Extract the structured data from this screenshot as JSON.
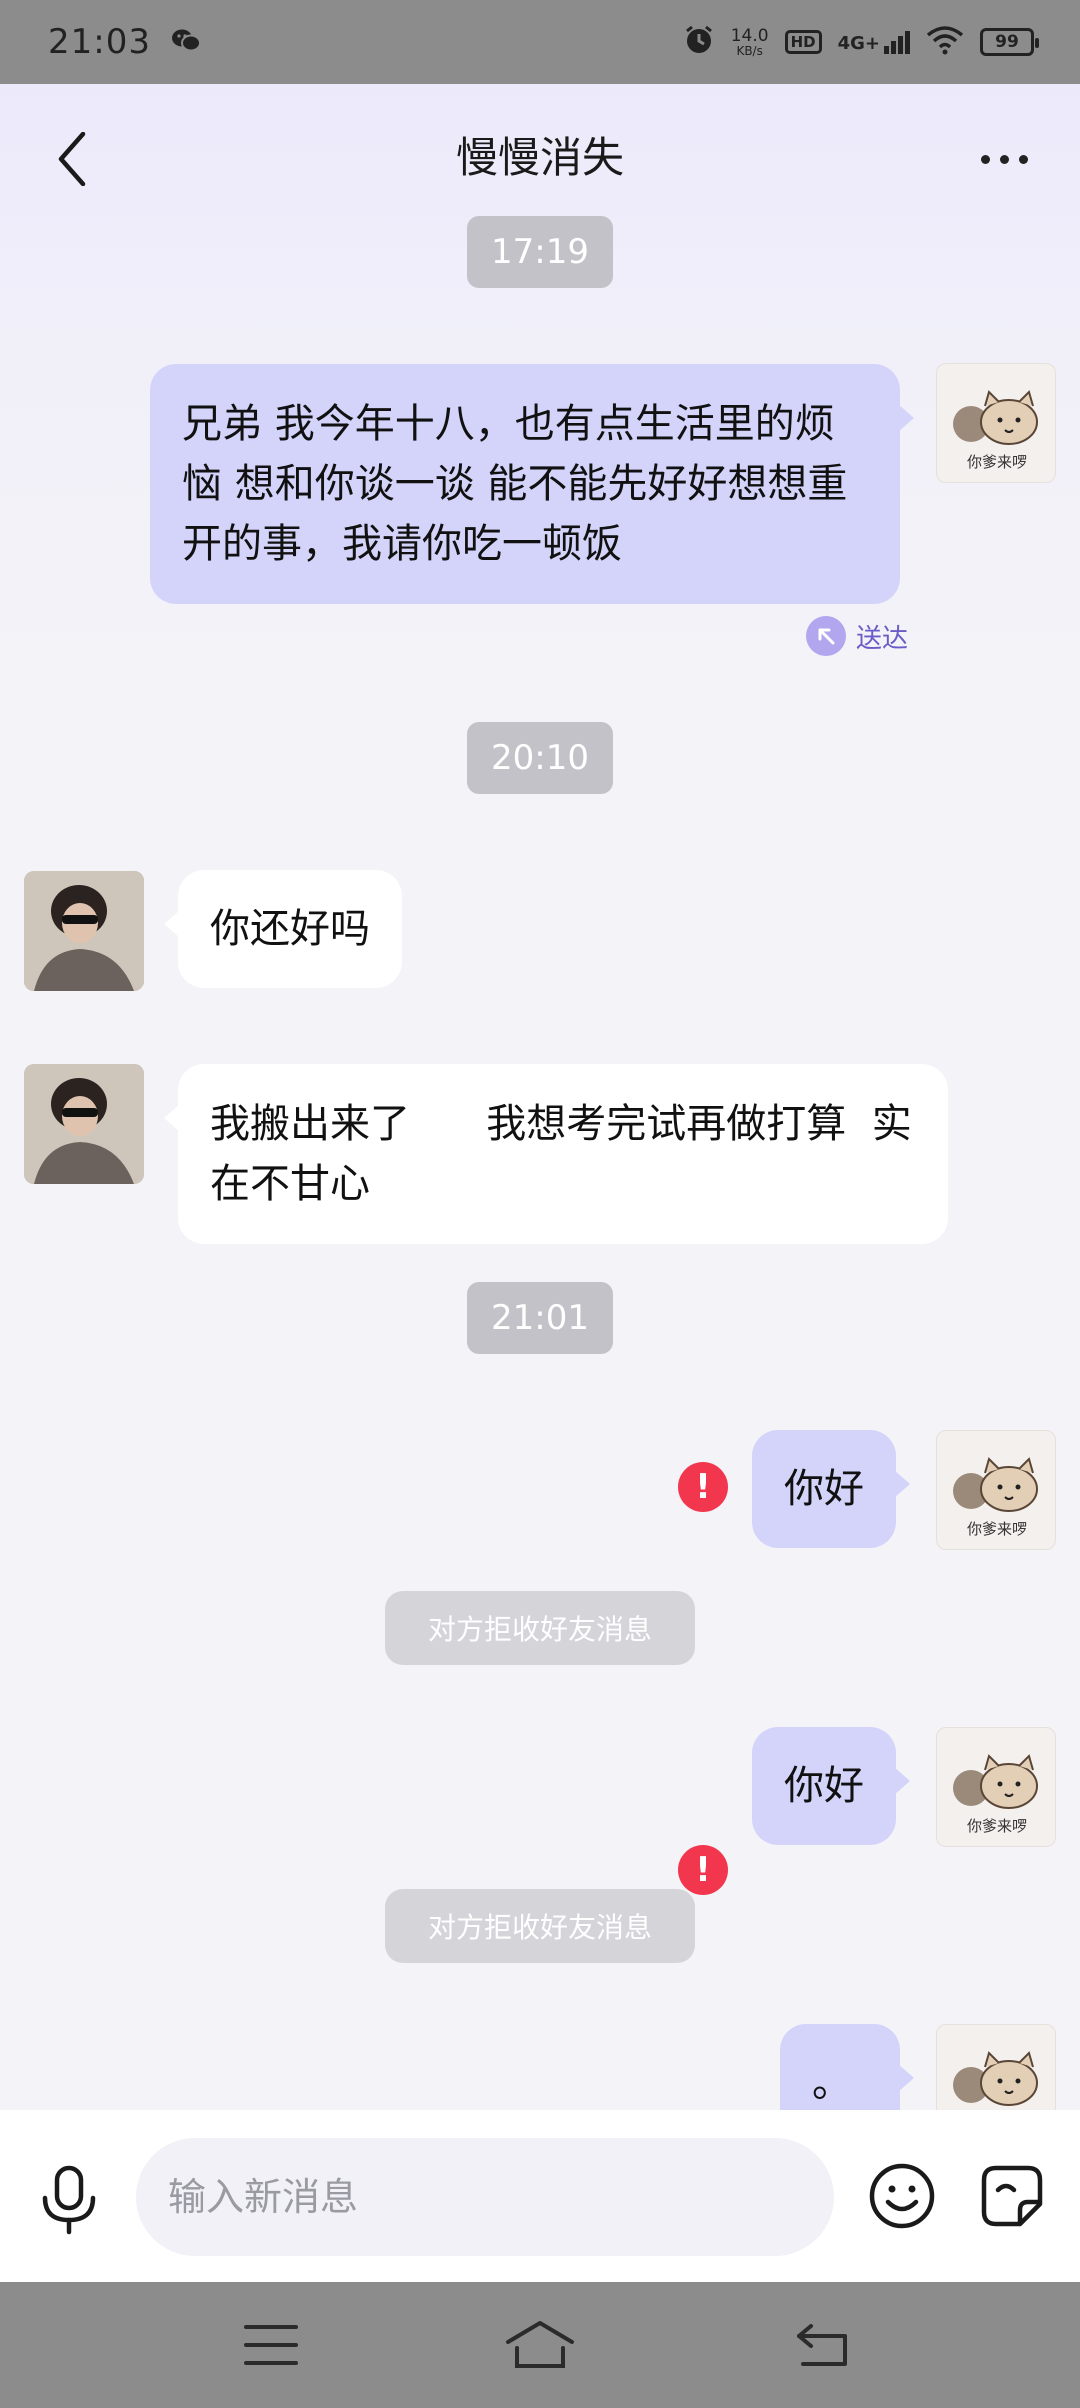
{
  "status_bar": {
    "time": "21:03",
    "net_speed_value": "14.0",
    "net_speed_unit": "KB/s",
    "hd_label": "HD",
    "network_label": "4G+",
    "battery_level": "99",
    "icons": [
      "wechat-icon",
      "alarm-icon",
      "hd-icon",
      "signal-icon",
      "wifi-icon",
      "battery-icon"
    ]
  },
  "header": {
    "title": "慢慢消失",
    "icons": [
      "back-icon",
      "more-icon"
    ]
  },
  "messages": {
    "time1": "17:19",
    "msg1_out": "兄弟  我今年十八，也有点生活里的烦恼  想和你谈一谈  能不能先好好想想重开的事，我请你吃一顿饭",
    "msg1_status": "送达",
    "time2": "20:10",
    "msg2_in": "你还好吗",
    "msg3_in": "我搬出来了      我想考完试再做打算  实在不甘心",
    "time3": "21:01",
    "msg4_out": "你好",
    "sys1": "对方拒收好友消息",
    "msg5_out": "你好",
    "sys2": "对方拒收好友消息",
    "msg6_out": "。",
    "sticker_caption": "你爹来啰"
  },
  "input_bar": {
    "placeholder": "输入新消息",
    "icons": [
      "mic-icon",
      "emoji-icon",
      "sticker-icon"
    ]
  },
  "nav_bar": {
    "icons": [
      "menu-icon",
      "home-icon",
      "back-nav-icon"
    ]
  },
  "colors": {
    "outgoing_bubble": "#d4d4fb",
    "incoming_bubble": "#ffffff",
    "error_red": "#f2364e",
    "delivered_purple": "#6a5cc7"
  }
}
